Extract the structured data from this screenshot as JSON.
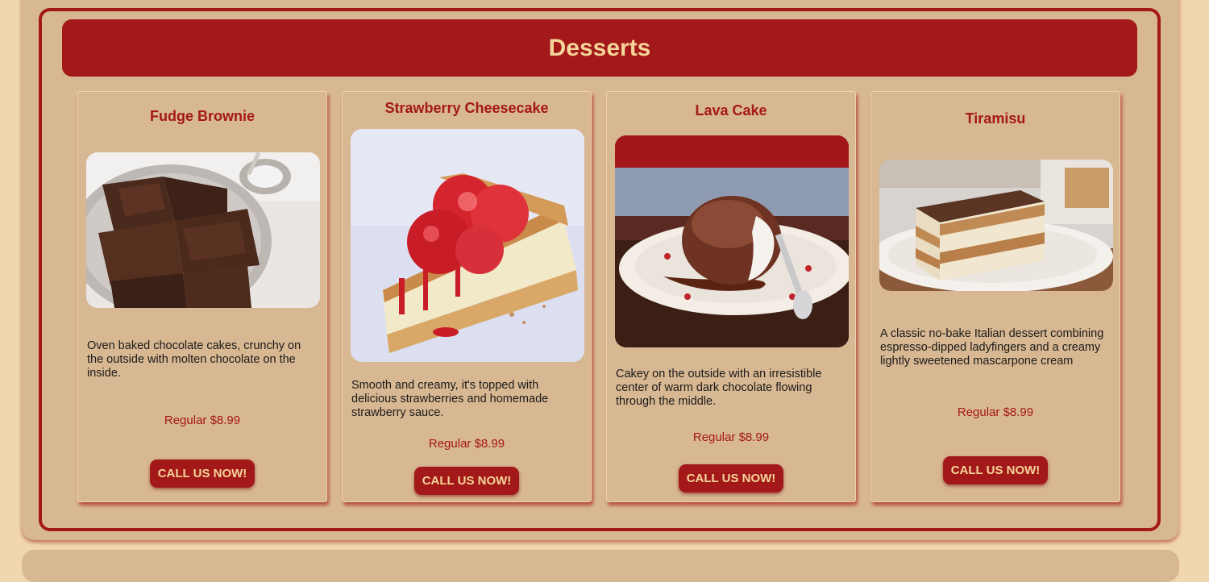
{
  "section": {
    "title": "Desserts"
  },
  "colors": {
    "accent": "#a31818",
    "accent_text": "#f5d59a",
    "panel": "#d8b892",
    "page_background": "#f1d7ad"
  },
  "items": [
    {
      "name": "Fudge Brownie",
      "description": "Oven baked chocolate cakes, crunchy on the outside with molten chocolate on the inside.",
      "price": "Regular $8.99",
      "button_label": "CALL US NOW!",
      "image": "brownie-photo"
    },
    {
      "name": "Strawberry Cheesecake",
      "description": "Smooth and creamy, it's topped with delicious strawberries and homemade strawberry sauce.",
      "price": "Regular $8.99",
      "button_label": "CALL US NOW!",
      "image": "cheesecake-photo"
    },
    {
      "name": "Lava Cake",
      "description": "Cakey on the outside with an irresistible center of warm dark chocolate flowing through the middle.",
      "price": "Regular $8.99",
      "button_label": "CALL US NOW!",
      "image": "lava-cake-photo"
    },
    {
      "name": "Tiramisu",
      "description": "A classic no-bake Italian dessert combining espresso-dipped ladyfingers and a creamy lightly sweetened mascarpone cream",
      "price": "Regular $8.99",
      "button_label": "CALL US NOW!",
      "image": "tiramisu-photo"
    }
  ]
}
